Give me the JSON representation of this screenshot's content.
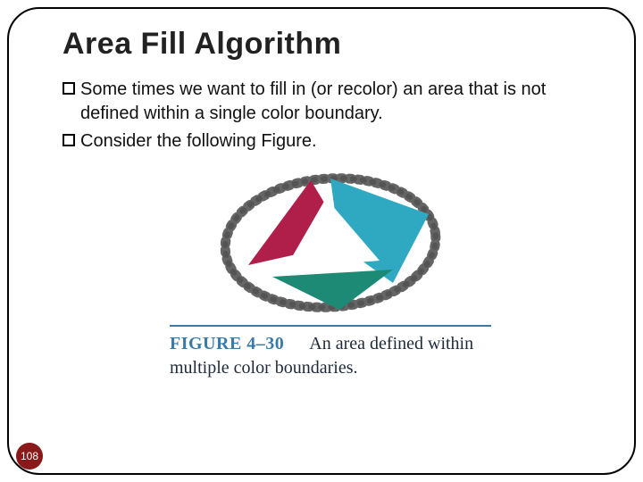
{
  "title": "Area Fill Algorithm",
  "bullets": [
    "Some times we want to fill in (or recolor) an area that is not defined within a single color boundary.",
    "Consider the following Figure."
  ],
  "figure": {
    "caption_label": "FIGURE 4–30",
    "caption_text": "An area defined within multiple color boundaries.",
    "colors": {
      "left_shape": "#b01f4a",
      "right_shape": "#2fa8c2",
      "bottom_shape": "#1c8a74",
      "center": "#ffffff",
      "brush": "#4a4a4a"
    }
  },
  "page_number": "108"
}
